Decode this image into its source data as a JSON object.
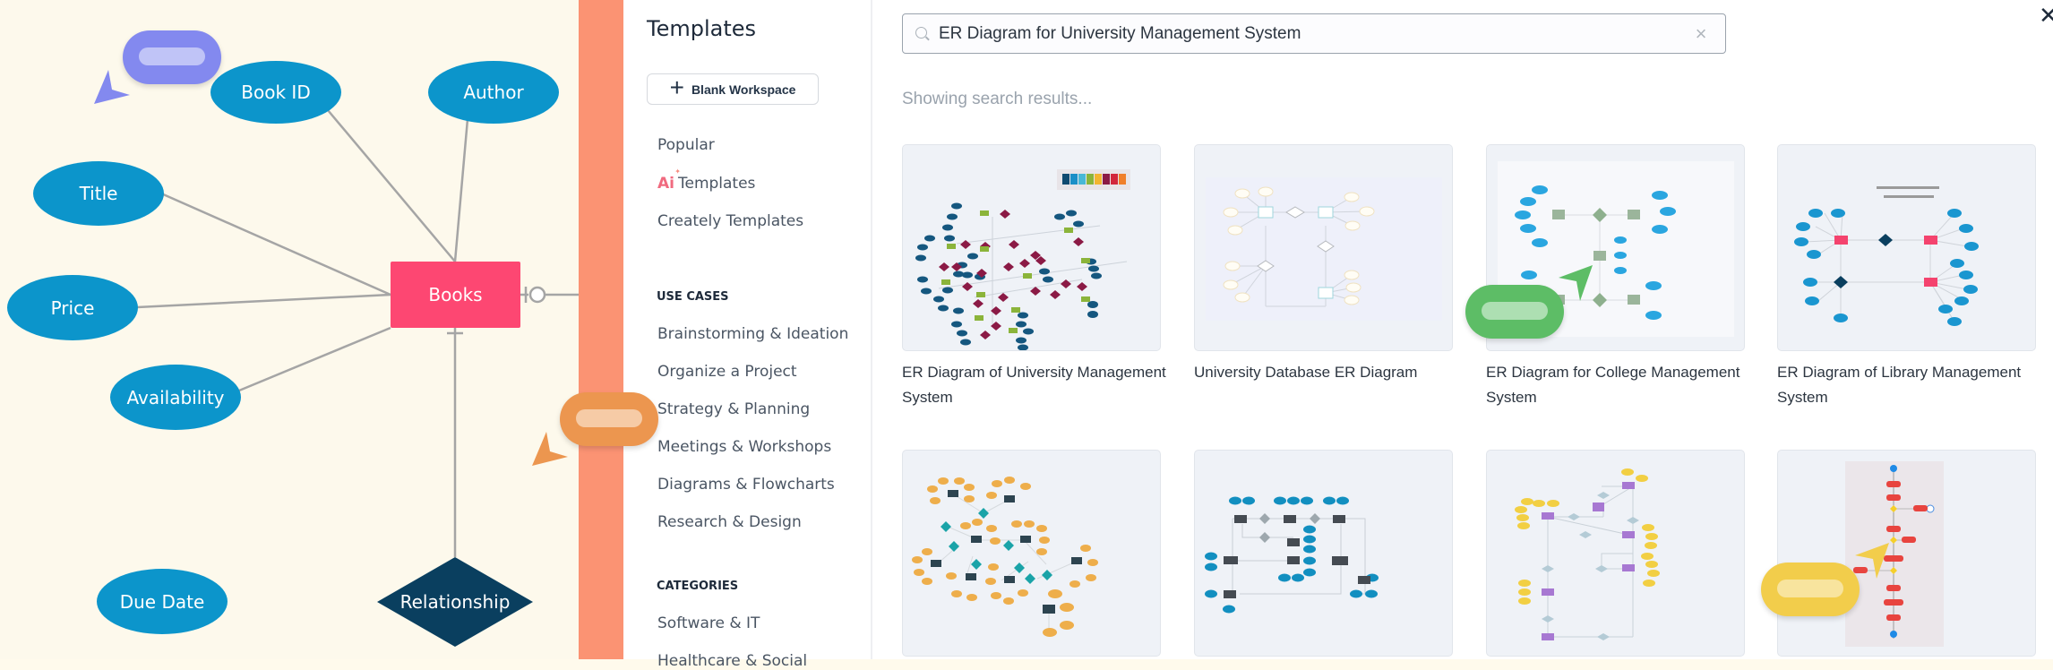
{
  "canvas": {
    "entity": "Books",
    "attributes": [
      "Book ID",
      "Author",
      "Title",
      "Price",
      "Availability",
      "Due Date"
    ],
    "relationship": "Relationship",
    "colors": {
      "attribute": "#0c95cb",
      "entity": "#fd4772",
      "relationship": "#0a3f5f",
      "connector": "#a5a5a5"
    }
  },
  "sidebar": {
    "title": "Templates",
    "blank_workspace_label": "Blank Workspace",
    "nav": [
      {
        "label": "Popular"
      },
      {
        "label": "Templates",
        "icon": "ai-icon"
      },
      {
        "label": "Creately Templates"
      }
    ],
    "use_cases_heading": "USE CASES",
    "use_cases": [
      "Brainstorming & Ideation",
      "Organize a Project",
      "Strategy & Planning",
      "Meetings & Workshops",
      "Diagrams & Flowcharts",
      "Research & Design"
    ],
    "categories_heading": "CATEGORIES",
    "categories": [
      "Software & IT",
      "Healthcare & Social"
    ]
  },
  "main": {
    "search": {
      "value": "ER Diagram for University Management System",
      "clear_icon": "clear-icon",
      "search_icon": "search-icon"
    },
    "close_icon": "close-icon",
    "status": "Showing search results...",
    "results": [
      {
        "title": "ER Diagram of University Management System"
      },
      {
        "title": "University Database ER Diagram"
      },
      {
        "title": "ER Diagram for College Management System"
      },
      {
        "title": "ER Diagram of Library Management System"
      },
      {
        "title": ""
      },
      {
        "title": ""
      },
      {
        "title": ""
      },
      {
        "title": ""
      }
    ]
  },
  "collaborators": [
    {
      "color": "#8389ef",
      "label_color": "#c0c4f7"
    },
    {
      "color": "#ec964f",
      "label_color": "#f6cba6"
    },
    {
      "color": "#5dbd66",
      "label_color": "#addfb2"
    },
    {
      "color": "#f2cd4b",
      "label_color": "#f8e49e"
    }
  ]
}
